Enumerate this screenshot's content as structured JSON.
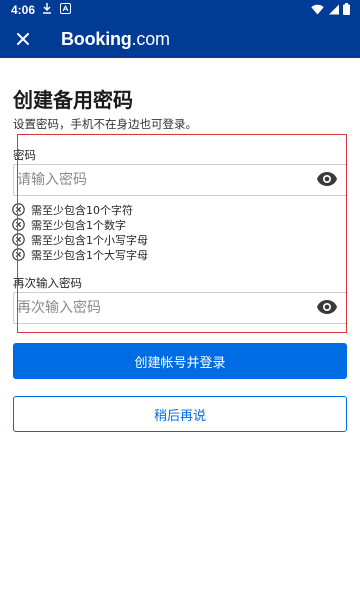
{
  "status_bar": {
    "time": "4:06",
    "icons": [
      "download-icon",
      "app-a-icon",
      "wifi-icon",
      "cellular-icon",
      "battery-icon"
    ]
  },
  "app_bar": {
    "brand_name": "Booking",
    "brand_suffix": ".com",
    "background_color": "#003b95",
    "close_icon": "close-icon"
  },
  "page": {
    "title": "创建备用密码",
    "subtitle": "设置密码，手机不在身边也可登录。"
  },
  "password_field": {
    "label": "密码",
    "placeholder": "请输入密码",
    "value": "",
    "toggle_icon": "eye-icon"
  },
  "requirements": [
    {
      "text": "需至少包含10个字符",
      "status": "unmet"
    },
    {
      "text": "需至少包含1个数字",
      "status": "unmet"
    },
    {
      "text": "需至少包含1个小写字母",
      "status": "unmet"
    },
    {
      "text": "需至少包含1个大写字母",
      "status": "unmet"
    }
  ],
  "confirm_field": {
    "label": "再次输入密码",
    "placeholder": "再次输入密码",
    "value": "",
    "toggle_icon": "eye-icon"
  },
  "buttons": {
    "primary_label": "创建帐号并登录",
    "secondary_label": "稍后再说"
  },
  "colors": {
    "accent": "#006ce4",
    "highlight": "#d9363e"
  }
}
